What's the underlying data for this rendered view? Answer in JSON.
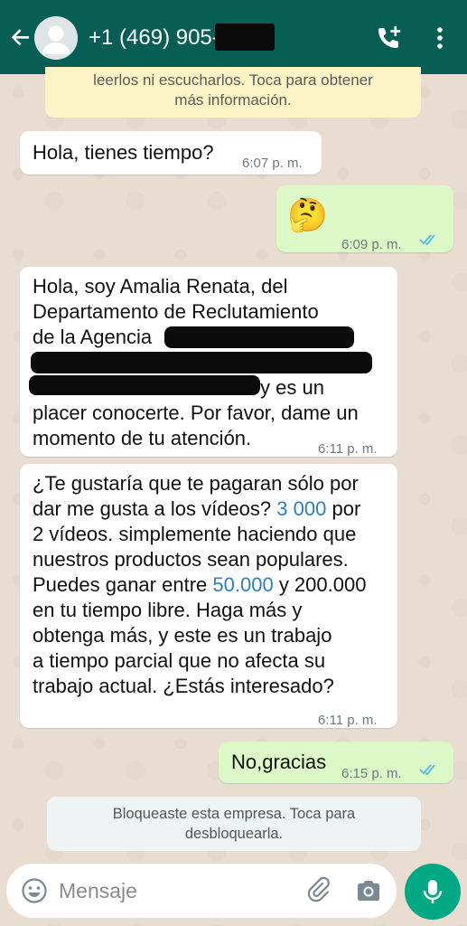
{
  "header": {
    "contact": "+1 (469) 905-"
  },
  "notices": {
    "top_line1": "leerlos ni escucharlos. Toca para obtener",
    "top_line2": "más información.",
    "bottom_line1": "Bloqueaste esta empresa. Toca para",
    "bottom_line2": "desbloquearla."
  },
  "messages": [
    {
      "direction": "in",
      "text": "Hola, tienes tiempo?",
      "time": "6:07 p. m."
    },
    {
      "direction": "out",
      "text": "🤔",
      "time": "6:09 p. m."
    },
    {
      "direction": "in",
      "lines": [
        "Hola, soy Amalia Renata, del",
        "Departamento de Reclutamiento",
        "de la Agencia",
        "y es un",
        "placer conocerte. Por favor, dame un",
        "momento de tu atención."
      ],
      "time": "6:11 p. m."
    },
    {
      "direction": "in",
      "lines": [
        "¿Te gustaría que te pagaran sólo por",
        "dar me gusta a los vídeos?",
        "3 000",
        "por",
        "2 vídeos. simplemente haciendo que",
        "nuestros productos sean populares.",
        "Puedes ganar entre",
        "50.000",
        "y 200.000",
        "en tu tiempo libre. Haga más y",
        "obtenga más, y este es un trabajo",
        "a tiempo parcial que no afecta su",
        "trabajo actual. ¿Estás interesado?"
      ],
      "time": "6:11 p. m."
    },
    {
      "direction": "out",
      "text": "No,gracias",
      "time": "6:15 p. m."
    }
  ],
  "composer": {
    "placeholder": "Mensaje"
  },
  "colors": {
    "header": "#075e54",
    "incoming_bubble": "#ffffff",
    "outgoing_bubble": "#dcf8c6",
    "read_ticks": "#4fb6ec",
    "link_number": "#2b7fc2",
    "mic_button": "#00a884"
  },
  "icons": [
    "back-arrow-icon",
    "avatar-icon",
    "add-call-icon",
    "more-vert-icon",
    "emoji-icon",
    "attach-icon",
    "camera-icon",
    "mic-icon",
    "double-check-icon"
  ]
}
